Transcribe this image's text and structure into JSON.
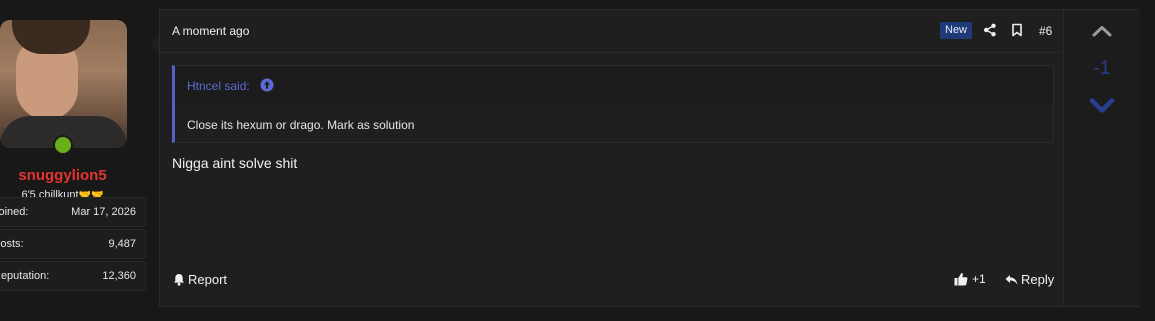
{
  "user": {
    "username": "snuggylion5",
    "title": "6'5 chillkunt",
    "title_emoji": "🤝🤝",
    "online": true,
    "stats": [
      {
        "label": "Joined:",
        "value": "Mar 17, 2026"
      },
      {
        "label": "Posts:",
        "value": "9,487"
      },
      {
        "label": "Reputation:",
        "value": "12,360"
      }
    ]
  },
  "post": {
    "timestamp": "A moment ago",
    "badge": "New",
    "number": "#6",
    "quote": {
      "author": "Htncel said:",
      "text": "Close its hexum or drago. Mark as solution"
    },
    "message": "Nigga aint solve shit",
    "footer": {
      "report_label": "Report",
      "like_count": "+1",
      "reply_label": "Reply"
    }
  },
  "votes": {
    "score": "-1"
  },
  "icons": {
    "header": [
      "share-icon",
      "bookmark-icon"
    ],
    "quote": "arrow-up-circle-icon",
    "vote": [
      "chevron-up-icon",
      "chevron-down-icon"
    ],
    "footer": [
      "bell-icon",
      "thumbs-up-icon",
      "reply-icon"
    ]
  },
  "colors": {
    "username": "#e3342f",
    "accent": "#5561c9",
    "badge": "#1f3a78",
    "online": "#6bb01a"
  }
}
